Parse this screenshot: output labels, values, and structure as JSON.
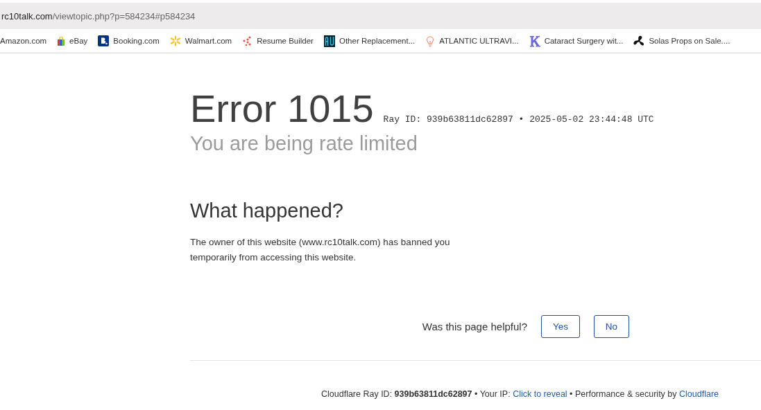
{
  "address_bar": {
    "host": "rc10talk.com",
    "path": "/viewtopic.php?p=584234#p584234"
  },
  "bookmarks": [
    {
      "kind": "none",
      "label": "Amazon.com"
    },
    {
      "kind": "bag",
      "label": "eBay"
    },
    {
      "kind": "letter-b",
      "label": "Booking.com"
    },
    {
      "kind": "spark",
      "label": "Walmart.com"
    },
    {
      "kind": "dots",
      "label": "Resume Builder"
    },
    {
      "kind": "au",
      "label": "Other Replacement..."
    },
    {
      "kind": "bulb",
      "label": "ATLANTIC ULTRAVI..."
    },
    {
      "kind": "k",
      "label": "Cataract Surgery wit..."
    },
    {
      "kind": "propeller",
      "label": "Solas Props on Sale...."
    }
  ],
  "error": {
    "title": "Error 1015",
    "ray": "Ray ID: 939b63811dc62897 • 2025-05-02 23:44:48 UTC",
    "subtitle": "You are being rate limited"
  },
  "what_happened": {
    "heading": "What happened?",
    "text": "The owner of this website (www.rc10talk.com) has banned you temporarily from accessing this website."
  },
  "feedback": {
    "question": "Was this page helpful?",
    "buttons": [
      "Yes",
      "No"
    ]
  },
  "footer": [
    {
      "kind": "text",
      "text": "Cloudflare Ray ID: **939b63811dc62897** • Your IP:"
    },
    {
      "kind": "link",
      "text": "Click to reveal"
    },
    {
      "kind": "text",
      "text": "• Performance & security by"
    },
    {
      "kind": "link",
      "text": "Cloudflare"
    }
  ]
}
